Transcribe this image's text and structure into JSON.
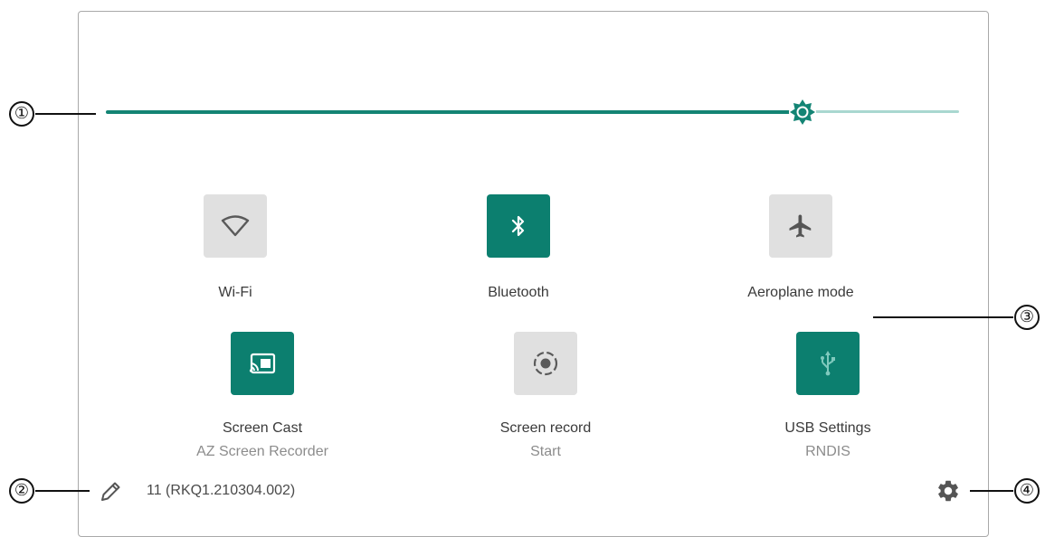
{
  "brightness": {
    "level_percent": 81
  },
  "tiles": [
    {
      "label": "Wi-Fi",
      "sublabel": "",
      "state": "off",
      "icon": "wifi-icon"
    },
    {
      "label": "Bluetooth",
      "sublabel": "",
      "state": "on",
      "icon": "bluetooth-icon"
    },
    {
      "label": "Aeroplane mode",
      "sublabel": "",
      "state": "off",
      "icon": "airplane-icon"
    },
    {
      "label": "Screen Cast",
      "sublabel": "AZ Screen Recorder",
      "state": "on",
      "icon": "cast-icon"
    },
    {
      "label": "Screen record",
      "sublabel": "Start",
      "state": "off",
      "icon": "screen-record-icon"
    },
    {
      "label": "USB Settings",
      "sublabel": "RNDIS",
      "state": "on",
      "icon": "usb-icon"
    }
  ],
  "footer": {
    "build": "11 (RKQ1.210304.002)",
    "edit_icon": "pencil-icon",
    "settings_icon": "gear-icon"
  },
  "callouts": {
    "c1": "①",
    "c2": "②",
    "c3": "③",
    "c4": "④"
  },
  "colors": {
    "accent": "#0c7f6f",
    "tile_off": "#e0e0e0",
    "track_rest": "#a9d7d0"
  }
}
